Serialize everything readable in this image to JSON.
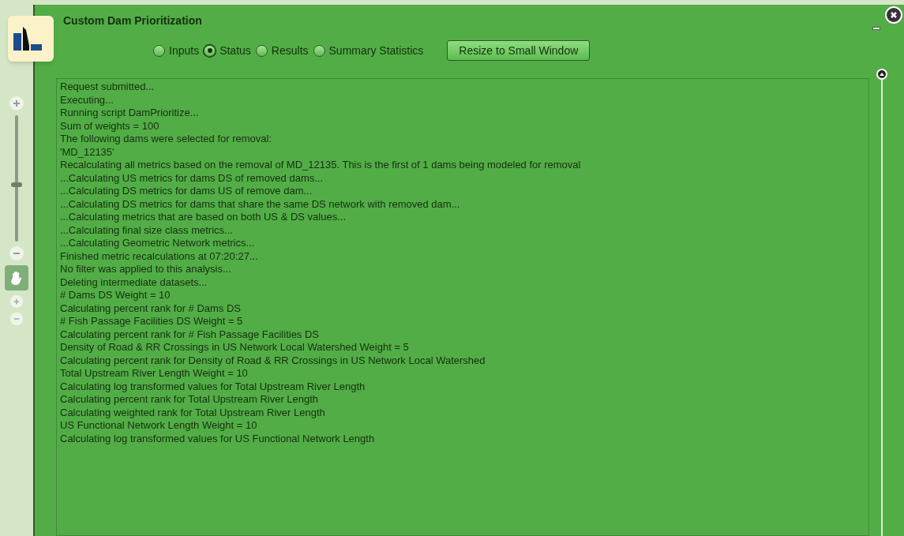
{
  "window": {
    "title": "Custom Dam Prioritization"
  },
  "tabs": [
    {
      "label": "Inputs",
      "selected": false
    },
    {
      "label": "Status",
      "selected": true
    },
    {
      "label": "Results",
      "selected": false
    },
    {
      "label": "Summary Statistics",
      "selected": false
    }
  ],
  "resize_button": "Resize to Small Window",
  "zoom_slider": {
    "level": 0.45
  },
  "log": [
    "Request submitted...",
    "Executing...",
    "Running script DamPrioritize...",
    "Sum of weights = 100",
    "The following dams were selected for removal:",
    "'MD_12135'",
    "Recalculating all metrics based on the removal of MD_12135. This is the first of 1 dams being modeled for removal",
    "...Calculating US metrics for dams DS of removed dams...",
    "...Calculating DS metrics for dams US of remove dam...",
    "...Calculating DS metrics for dams that share the same DS network with removed dam...",
    "...Calculating metrics that are based on both US & DS values...",
    "...Calculating final size class metrics...",
    "...Calculating Geometric Network metrics...",
    "Finished metric recalculations at 07:20:27...",
    "No filter was applied to this analysis...",
    "Deleting intermediate datasets...",
    "# Dams DS Weight = 10",
    "Calculating percent rank for # Dams DS",
    "# Fish Passage Facilities DS Weight = 5",
    "Calculating percent rank for # Fish Passage Facilities DS",
    "Density of Road & RR Crossings in US Network Local Watershed Weight = 5",
    "Calculating percent rank for Density of Road & RR Crossings in US Network Local Watershed",
    "Total Upstream River Length Weight = 10",
    "Calculating log transformed values for Total Upstream River Length",
    "Calculating percent rank for Total Upstream River Length",
    "Calculating weighted rank for Total Upstream River Length",
    "US Functional Network Length Weight = 10",
    "Calculating log transformed values for US Functional Network Length"
  ]
}
